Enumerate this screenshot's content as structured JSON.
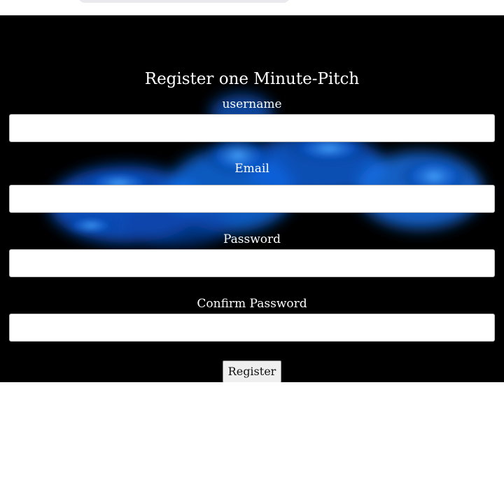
{
  "form": {
    "title": "Register one Minute-Pitch",
    "fields": [
      {
        "label": "username",
        "value": ""
      },
      {
        "label": "Email",
        "value": ""
      },
      {
        "label": "Password",
        "value": ""
      },
      {
        "label": "Confirm Password",
        "value": ""
      }
    ],
    "submit_label": "Register"
  },
  "colors": {
    "background": "#000000",
    "smoke": "#1a6fe0",
    "text": "#ffffff"
  }
}
